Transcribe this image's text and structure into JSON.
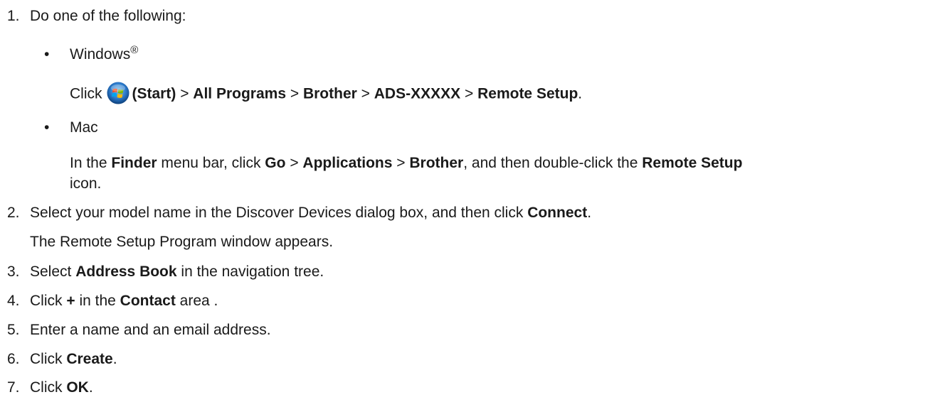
{
  "steps": [
    {
      "num": "1.",
      "text": "Do one of the following:"
    },
    {
      "num": "2.",
      "pre": "Select your model name in the Discover Devices dialog box, and then click ",
      "bold": "Connect",
      "post": ".",
      "note": "The Remote Setup Program window appears."
    },
    {
      "num": "3.",
      "pre": "Select ",
      "bold": "Address Book",
      "post": " in the navigation tree."
    },
    {
      "num": "4.",
      "pre": "Click ",
      "bold": "+",
      "mid": " in the ",
      "bold2": "Contact",
      "post": " area ."
    },
    {
      "num": "5.",
      "text": "Enter a name and an email address."
    },
    {
      "num": "6.",
      "pre": "Click ",
      "bold": "Create",
      "post": "."
    },
    {
      "num": "7.",
      "pre": "Click ",
      "bold": "OK",
      "post": "."
    }
  ],
  "windows": {
    "bullet": "•",
    "label": "Windows",
    "reg": "®",
    "click": "Click",
    "start": "(Start)",
    "sep": ">",
    "all_programs": "All Programs",
    "brother": "Brother",
    "model": "ADS-XXXXX",
    "remote_setup": "Remote Setup",
    "end": "."
  },
  "mac": {
    "bullet": "•",
    "label": "Mac",
    "t1": "In the ",
    "finder": "Finder",
    "t2": " menu bar, click ",
    "go": "Go",
    "sep": ">",
    "applications": "Applications",
    "brother": "Brother",
    "t3": ", and then double-click the ",
    "remote_setup": "Remote Setup",
    "t4": "icon."
  },
  "icons": {
    "start": "windows-start-orb-icon"
  },
  "colors": {
    "text": "#1a1a1a",
    "orb": "#2a78c9"
  }
}
